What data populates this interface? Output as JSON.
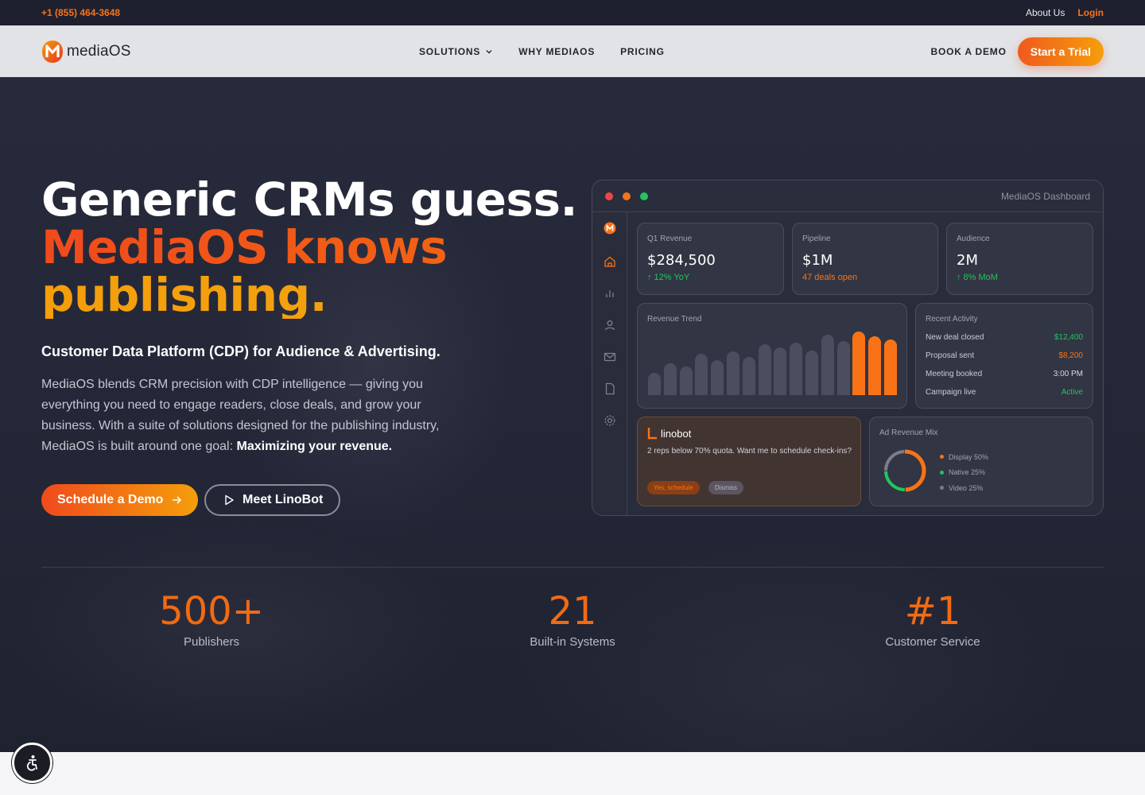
{
  "topbar": {
    "phone": "+1 (855) 464-3648",
    "about": "About Us",
    "login": "Login"
  },
  "nav": {
    "logo_text": "mediaOS",
    "menu": [
      "SOLUTIONS",
      "WHY MEDIAOS",
      "PRICING"
    ],
    "book_demo": "BOOK A DEMO",
    "start_trial": "Start a Trial"
  },
  "hero": {
    "headline_1": "Generic CRMs guess.",
    "headline_2": "MediaOS knows",
    "headline_3": "publishing.",
    "subheadline": "Customer Data Platform (CDP) for Audience & Advertising.",
    "paragraph": "MediaOS blends CRM precision with CDP intelligence — giving you everything you need to engage readers, close deals, and grow your business. With a suite of solutions designed for the publishing industry, MediaOS is built around one goal:",
    "paragraph_bold": "Maximizing your revenue.",
    "cta_primary": "Schedule a Demo",
    "cta_secondary": "Meet LinoBot"
  },
  "dashboard": {
    "title": "MediaOS Dashboard",
    "kpis": [
      {
        "label": "Q1 Revenue",
        "value": "$284,500",
        "sub": "↑ 12% YoY"
      },
      {
        "label": "Pipeline",
        "value": "$1M",
        "sub": "47 deals open"
      },
      {
        "label": "Audience",
        "value": "2M",
        "sub": "↑ 8% MoM"
      }
    ],
    "trend": {
      "label": "Revenue Trend",
      "values": [
        28,
        40,
        36,
        52,
        44,
        55,
        48,
        64,
        60,
        66,
        56,
        76,
        68,
        80,
        74,
        70
      ],
      "highlight_from": 13,
      "colors": {
        "bar": "#4b4e5e",
        "highlight": "#f97316"
      }
    },
    "activity": {
      "label": "Recent Activity",
      "rows": [
        {
          "name": "New deal closed",
          "value": "$12,400",
          "color": "#22c55e"
        },
        {
          "name": "Proposal sent",
          "value": "$8,200",
          "color": "#f97316"
        },
        {
          "name": "Meeting booked",
          "value": "3:00 PM",
          "color": "#d7d9e0"
        },
        {
          "name": "Campaign live",
          "value": "Active",
          "color": "#22c55e"
        }
      ]
    },
    "linobot": {
      "name": "linobot",
      "message": "2 reps below 70% quota. Want me to schedule check-ins?",
      "accept": "Yes, schedule",
      "dismiss": "Dismiss"
    },
    "ad_mix": {
      "label": "Ad Revenue Mix",
      "legend": [
        {
          "name": "Display 50%",
          "share": 50,
          "color": "#f97316"
        },
        {
          "name": "Native 25%",
          "share": 25,
          "color": "#22c55e"
        },
        {
          "name": "Video 25%",
          "share": 25,
          "color": "#7a7d8c"
        }
      ]
    }
  },
  "stats": [
    {
      "value": "500+",
      "label": "Publishers"
    },
    {
      "value": "21",
      "label": "Built-in Systems"
    },
    {
      "value": "#1",
      "label": "Customer Service"
    }
  ],
  "icons": {
    "brand": "mediaos-logo",
    "accessibility": "accessibility-icon"
  },
  "colors": {
    "accent": "#f97316",
    "accent_red": "#f04a1c",
    "accent_amber": "#f59e0b"
  }
}
